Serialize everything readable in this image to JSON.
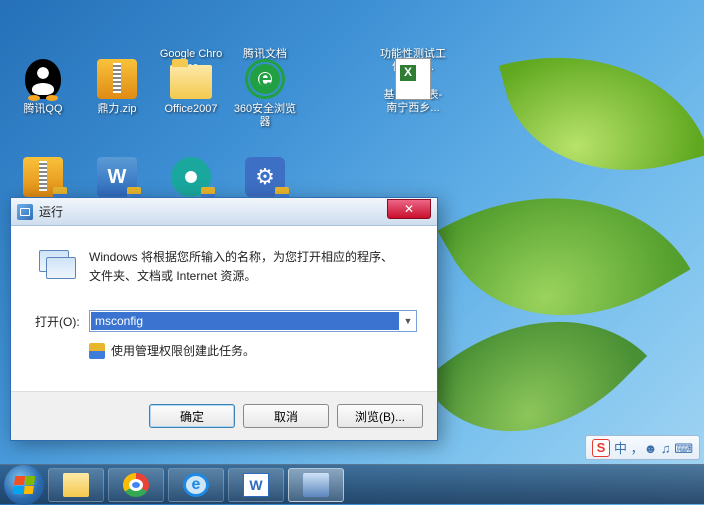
{
  "desktop": {
    "icons_row1": [
      {
        "label": "",
        "icon": "blank"
      },
      {
        "label": "",
        "icon": "blank"
      },
      {
        "label": "Google Chrome",
        "icon": "chrome"
      },
      {
        "label": "腾讯文档",
        "icon": "doc"
      },
      {
        "label": "",
        "icon": "blank"
      },
      {
        "label": "功能性测试工作量汇...",
        "icon": "xls"
      }
    ],
    "icons_row2": [
      {
        "label": "腾讯QQ",
        "icon": "qq"
      },
      {
        "label": "鼎力.zip",
        "icon": "zip"
      },
      {
        "label": "Office2007",
        "icon": "folder"
      },
      {
        "label": "360安全浏览器",
        "icon": "e360"
      },
      {
        "label": "",
        "icon": "blank"
      },
      {
        "label": "基站勘察表-南宁西乡...",
        "icon": "xls"
      }
    ],
    "icons_row3": [
      {
        "label": "",
        "icon": "zip"
      },
      {
        "label": "",
        "icon": "word"
      },
      {
        "label": "",
        "icon": "swirl"
      },
      {
        "label": "",
        "icon": "gear"
      }
    ]
  },
  "run_dialog": {
    "title": "运行",
    "description_line1": "Windows 将根据您所输入的名称，为您打开相应的程序、",
    "description_line2": "文件夹、文档或 Internet 资源。",
    "open_label": "打开(O):",
    "open_value": "msconfig",
    "uac_text": "使用管理权限创建此任务。",
    "ok": "确定",
    "cancel": "取消",
    "browse": "浏览(B)..."
  },
  "tray": {
    "sogou": "S",
    "items": "中 ，☻ ♫ ⌨"
  }
}
